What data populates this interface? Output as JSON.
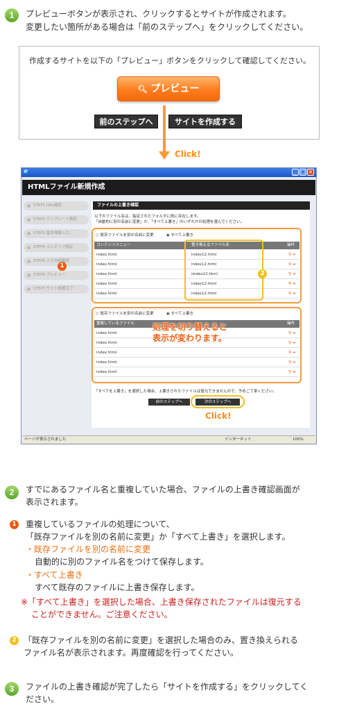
{
  "step1": {
    "num": "1",
    "line1": "プレビューボタンが表示され、クリックするとサイトが作成されます。",
    "line2": "変更したい箇所がある場合は「前のステップへ」をクリックしてください。"
  },
  "preview_box": {
    "instruction": "作成するサイトを以下の「プレビュー」ボタンをクリックして確認してください。",
    "preview_label": "プレビュー",
    "prev_step_label": "前のステップへ",
    "create_site_label": "サイトを作成する"
  },
  "click_label_1": "Click!",
  "window": {
    "app_title": "HTMLファイル新規作成",
    "sidebar": [
      {
        "label": "STEP1 URL確認"
      },
      {
        "label": "STEP2 テンプレート選択"
      },
      {
        "label": "STEP3 基本情報入力"
      },
      {
        "label": "STEP4 コンテンツ設定"
      },
      {
        "label": "STEP5 入力内容確認"
      },
      {
        "label": "STEP6 プレビュー"
      },
      {
        "label": "STEP7 サイト設置完了!"
      }
    ],
    "panel_title": "ファイルの上書き確認",
    "desc1": "以下のファイル名は、指定されたフォルダに既に存在します。",
    "desc2": "「自動的に別の名前に変更」か、「すべて上書き」のいずれかの処理を選んでください。",
    "radio_rename": "既存ファイルを別の名前に変更",
    "radio_overwrite": "すべて上書き",
    "table1": {
      "col_menu": "コンテンツメニュー",
      "col_replace": "置き換えるファイル名",
      "col_op": "操作",
      "rows": [
        {
          "name": "index.html",
          "replace": "index12.html"
        },
        {
          "name": "index.html",
          "replace": "index12.html"
        },
        {
          "name": "index.html",
          "replace": "iindex12.html"
        },
        {
          "name": "index.html",
          "replace": "index12.html"
        },
        {
          "name": "index.html",
          "replace": "index12.html"
        }
      ]
    },
    "table2": {
      "col_dup": "重複しているファイル",
      "col_op": "操作",
      "rows": [
        "index.html",
        "index.html",
        "index.html",
        "index.html",
        "index.html"
      ]
    },
    "overlay_line1": "処理を切り替えると",
    "overlay_line2": "表示が変わります。",
    "warning": "「すべてを上書き」を選択した場合、上書きされたファイルは復元できませんので、予めご了承ください。",
    "prev_btn": "前のステップへ",
    "next_btn": "次のステップへ",
    "click_label": "Click!",
    "status_left": "ページが表示されました",
    "status_zone": "インターネット",
    "status_zoom": "100%"
  },
  "markers": {
    "one": "1",
    "two": "2"
  },
  "step2": {
    "num": "2",
    "line1": "すでにあるファイル名と重複していた場合、ファイルの上書き確認画面が",
    "line2": "表示されます。"
  },
  "note1": {
    "num": "1",
    "line1": "重複しているファイルの処理について、",
    "line2": "「既存ファイルを別の名前に変更」か「すべて上書き」を選択します。",
    "opt1_title": "・既存ファイルを別の名前に変更",
    "opt1_desc": "自動的に別のファイル名をつけて保存します。",
    "opt2_title": "・すべて上書き",
    "opt2_desc": "すべて既存のファイルに上書き保存します。",
    "caution1": "※「すべて上書き」を選択した場合、上書き保存されたファイルは復元する",
    "caution2": "ことができません。ご注意ください。"
  },
  "note2": {
    "num": "2",
    "line1": "「既存ファイルを別の名前に変更」を選択した場合のみ、置き換えられる",
    "line2": "ファイル名が表示されます。再度確認を行ってください。"
  },
  "step3": {
    "num": "3",
    "line1": "ファイルの上書き確認が完了したら「サイトを作成する」をクリックしてく",
    "line2": "ださい。"
  },
  "colors": {
    "orange": "#ff7c1e",
    "green": "#6ab53a",
    "dark": "#222222",
    "red": "#cc1f1f"
  }
}
